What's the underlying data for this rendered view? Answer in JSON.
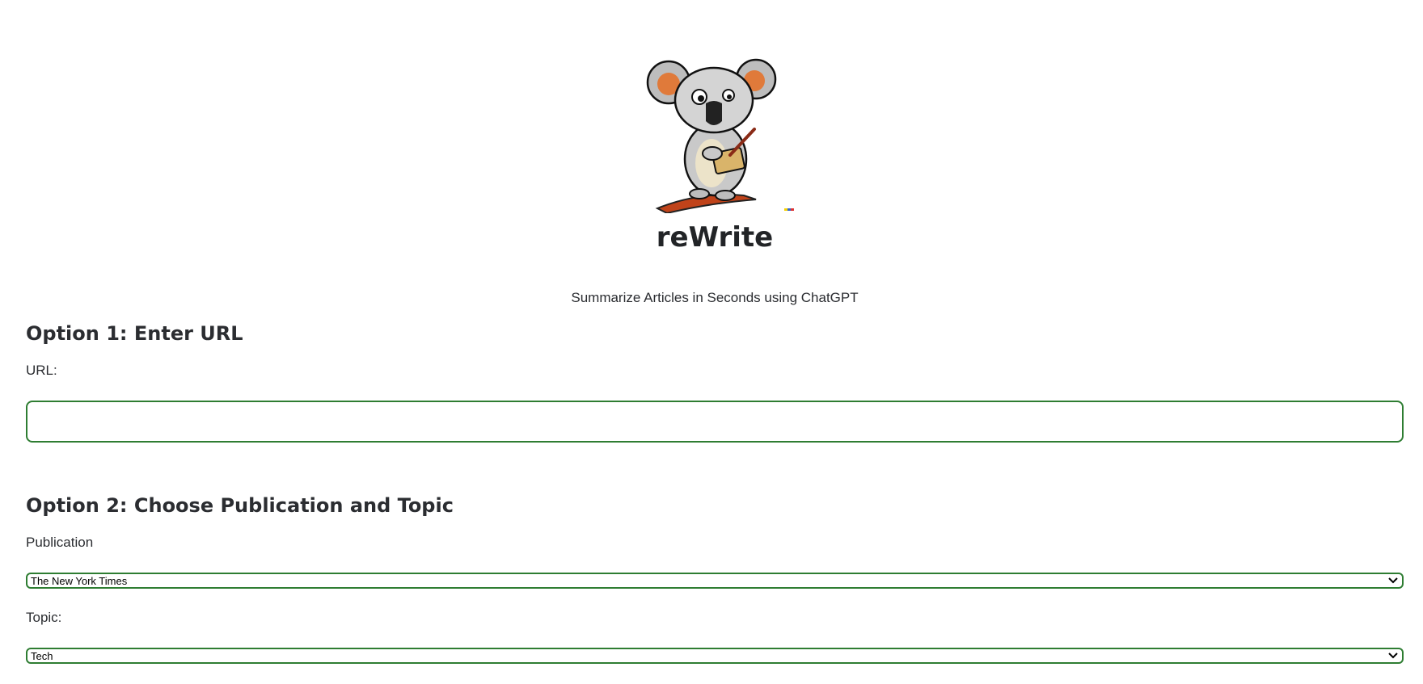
{
  "app": {
    "title": "reWrite",
    "tagline": "Summarize Articles in Seconds using ChatGPT",
    "logo_icon": "koala-writing-icon"
  },
  "option1": {
    "heading": "Option 1: Enter URL",
    "url_label": "URL:",
    "url_value": ""
  },
  "option2": {
    "heading": "Option 2: Choose Publication and Topic",
    "publication_label": "Publication",
    "publication_selected": "The New York Times",
    "topic_label": "Topic:",
    "topic_selected": "Tech"
  },
  "colors": {
    "accent_border": "#2e7d32",
    "text": "#2b2d31"
  }
}
